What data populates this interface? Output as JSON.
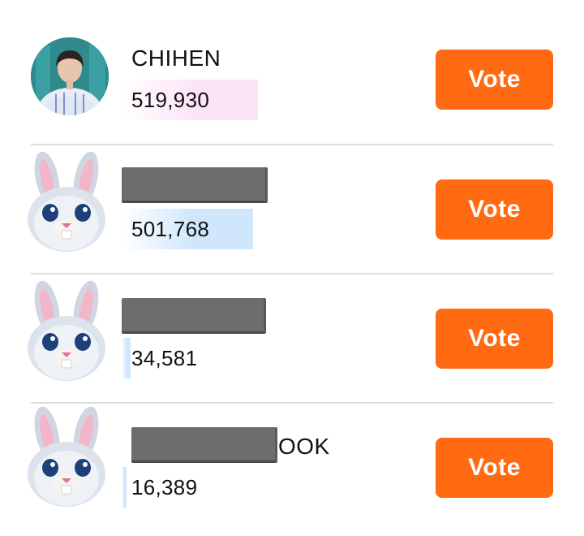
{
  "entries": [
    {
      "name": "CHIHEN",
      "votes": "519,930",
      "vote_label": "Vote",
      "avatar": "person-photo",
      "bar_fraction": 1.0,
      "bar_color": "#fde3f7"
    },
    {
      "name": "",
      "votes": "501,768",
      "vote_label": "Vote",
      "avatar": "bunny-avatar",
      "bar_fraction": 0.965,
      "bar_color": "#cfe6fd"
    },
    {
      "name": "",
      "votes": "34,581",
      "vote_label": "Vote",
      "avatar": "bunny-avatar",
      "bar_fraction": 0.066,
      "bar_color": "#cfe6fd"
    },
    {
      "name": "OOK",
      "votes": "16,389",
      "vote_label": "Vote",
      "avatar": "bunny-avatar",
      "bar_fraction": 0.032,
      "bar_color": "#cfe6fd"
    }
  ],
  "colors": {
    "vote_button": "#ff6a13",
    "divider": "#dedede"
  }
}
